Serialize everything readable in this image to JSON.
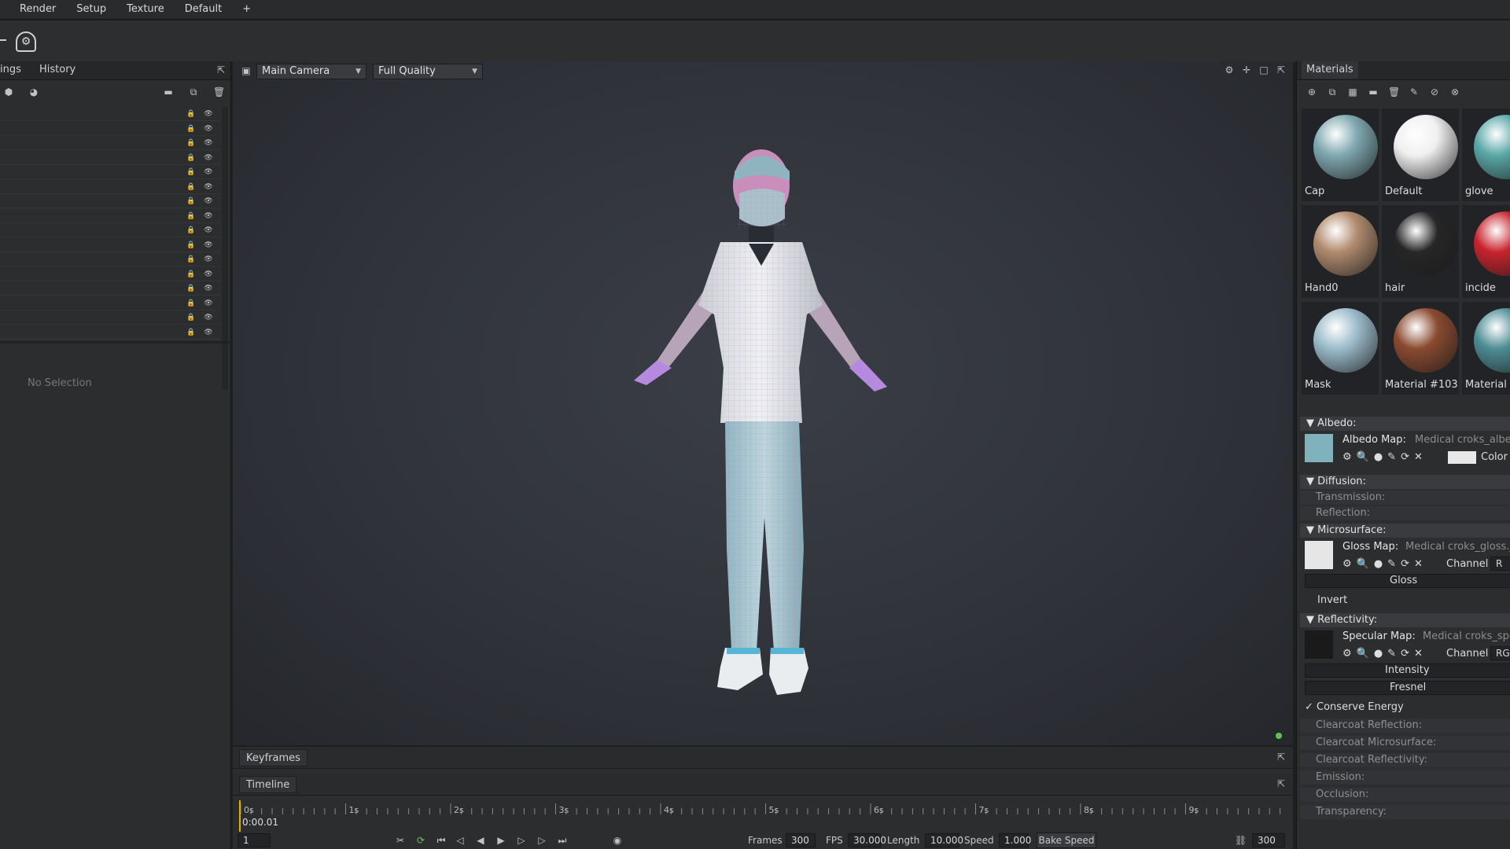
{
  "menu": [
    "Render",
    "Setup",
    "Texture",
    "Default",
    "+"
  ],
  "left_panel": {
    "tabs": [
      "ings",
      "History"
    ],
    "no_selection": "No Selection"
  },
  "viewport": {
    "camera": "Main Camera",
    "quality": "Full Quality"
  },
  "materials": {
    "tab": "Materials",
    "items": [
      {
        "name": "Cap",
        "color": "#7fa8b0"
      },
      {
        "name": "Default",
        "color": "#f0f0f0"
      },
      {
        "name": "glove",
        "color": "#5aa7a8"
      },
      {
        "name": "Hand0",
        "color": "#b08a6e"
      },
      {
        "name": "hair",
        "color": "#262626"
      },
      {
        "name": "incide",
        "color": "#c8232d"
      },
      {
        "name": "Mask",
        "color": "#9cbccc"
      },
      {
        "name": "Material #103",
        "color": "#8a4a30"
      },
      {
        "name": "Material #",
        "color": "#4d8d94"
      }
    ],
    "albedo": {
      "header": "Albedo:",
      "map_label": "Albedo Map:",
      "map_file": "Medical croks_albed",
      "color_label": "Color"
    },
    "diffusion": {
      "header": "Diffusion:",
      "transmission": "Transmission:",
      "reflection": "Reflection:"
    },
    "microsurface": {
      "header": "Microsurface:",
      "map_label": "Gloss Map:",
      "map_file": "Medical croks_gloss.jp",
      "channel_label": "Channel",
      "channel_value": "R",
      "gloss_label": "Gloss",
      "invert_label": "Invert"
    },
    "reflectivity": {
      "header": "Reflectivity:",
      "map_label": "Specular Map:",
      "map_file": "Medical croks_spec",
      "channel_label": "Channel",
      "channel_value": "RGB",
      "intensity_label": "Intensity",
      "fresnel_label": "Fresnel",
      "conserve_label": "Conserve Energy"
    },
    "extra": [
      "Clearcoat Reflection:",
      "Clearcoat Microsurface:",
      "Clearcoat Reflectivity:",
      "Emission:",
      "Occlusion:",
      "Transparency:"
    ]
  },
  "keyframes": {
    "tab": "Keyframes"
  },
  "timeline": {
    "tab": "Timeline",
    "ticks": [
      "0s",
      "1s",
      "2s",
      "3s",
      "4s",
      "5s",
      "6s",
      "7s",
      "8s",
      "9s"
    ],
    "current_time": "0:00.01",
    "frame": "1",
    "frames_label": "Frames",
    "frames_value": "300",
    "fps_label": "FPS",
    "fps_value": "30.000",
    "length_label": "Length",
    "length_value": "10.000",
    "speed_label": "Speed",
    "speed_value": "1.000",
    "bake_label": "Bake Speed",
    "end_frame": "300"
  },
  "colors": {
    "accent_green": "#5fc24a",
    "wire": "#c96bd9"
  }
}
